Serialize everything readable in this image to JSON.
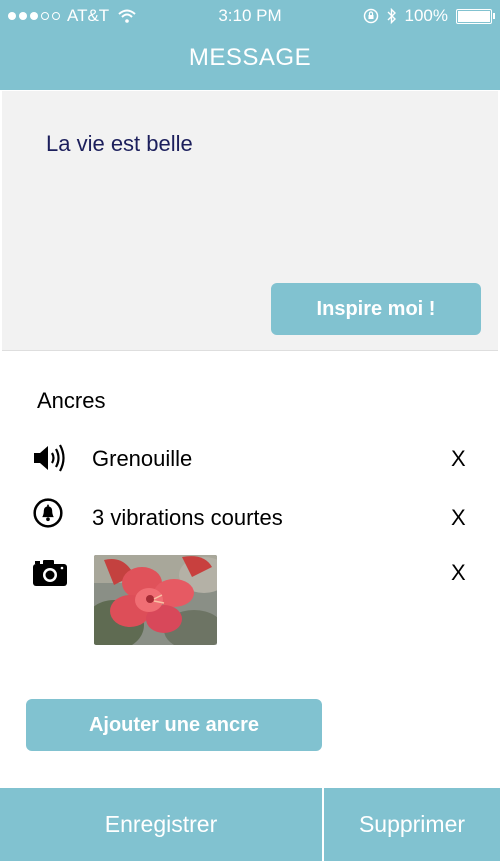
{
  "status_bar": {
    "signal_bars_filled": 3,
    "signal_bars_total": 5,
    "carrier": "AT&T",
    "time": "3:10 PM",
    "battery_label": "100%",
    "battery_level": 1.0,
    "icons": [
      "wifi-icon",
      "rotation-lock-icon",
      "bluetooth-icon",
      "battery-icon"
    ]
  },
  "nav": {
    "title": "MESSAGE"
  },
  "message": {
    "text": "La vie est belle",
    "inspire_label": "Inspire moi !"
  },
  "anchors": {
    "title": "Ancres",
    "items": [
      {
        "icon": "speaker-icon",
        "label": "Grenouille",
        "remove_label": "X"
      },
      {
        "icon": "bell-vibration-icon",
        "label": "3 vibrations courtes",
        "remove_label": "X"
      },
      {
        "icon": "camera-icon",
        "label": "",
        "remove_label": "X",
        "has_photo": true
      }
    ],
    "add_label": "Ajouter une ancre"
  },
  "toolbar": {
    "save_label": "Enregistrer",
    "delete_label": "Supprimer"
  },
  "colors": {
    "accent": "#81c2d0",
    "message_bg": "#f2f2f2",
    "message_text": "#1c1f5c"
  }
}
